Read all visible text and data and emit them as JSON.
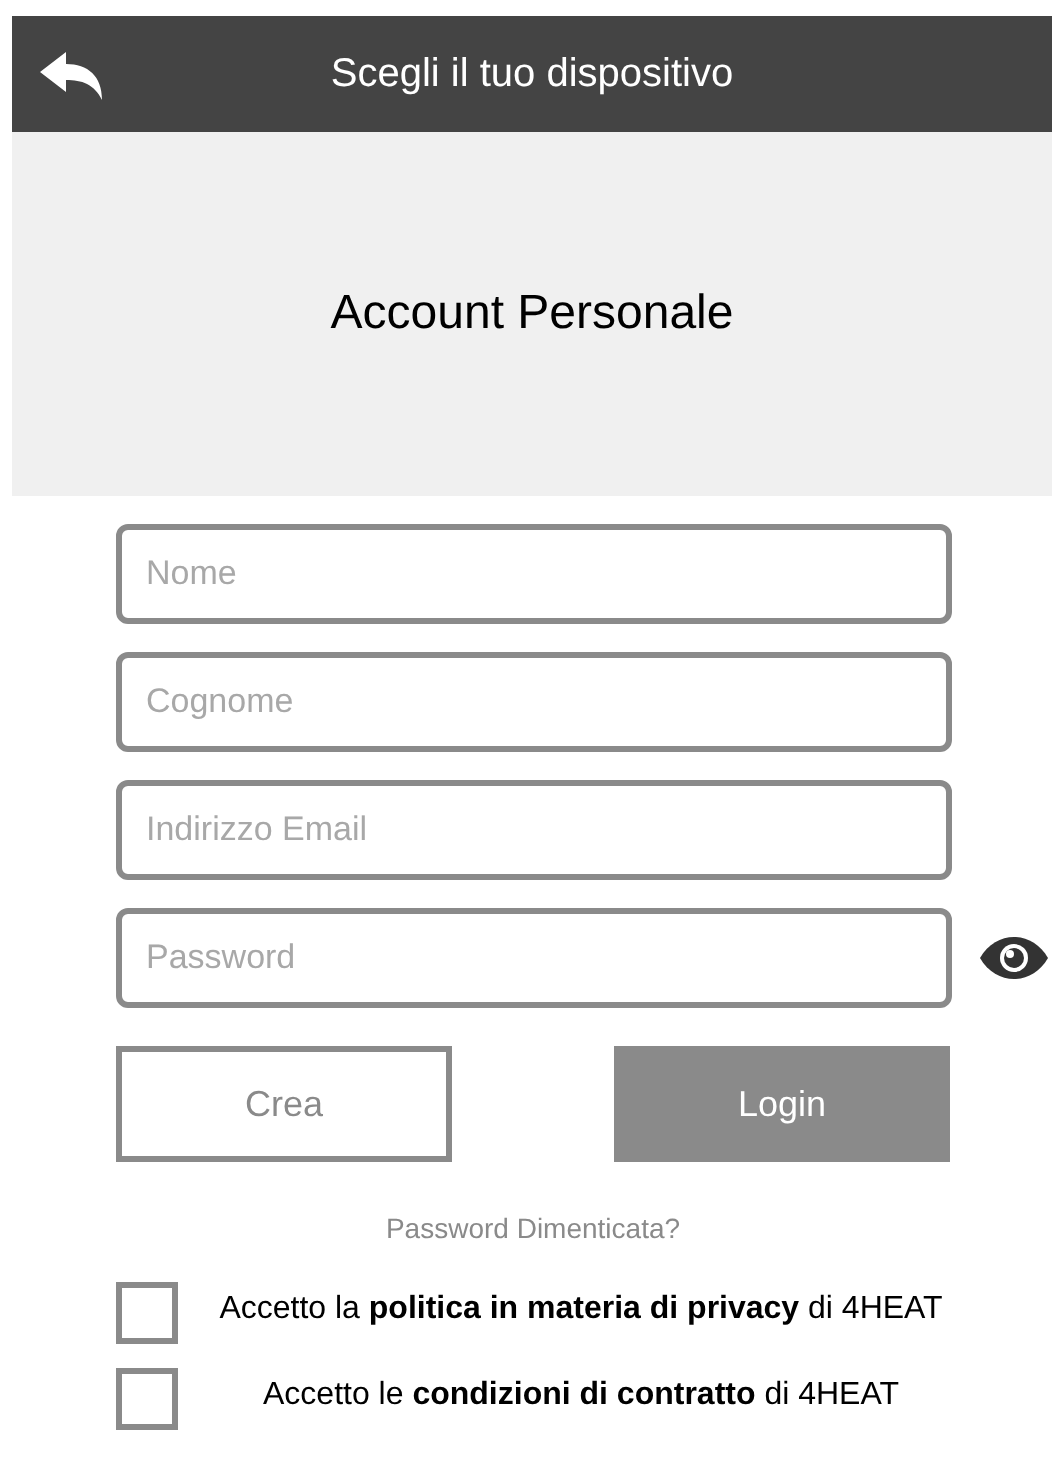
{
  "header": {
    "title": "Scegli il tuo dispositivo"
  },
  "banner": {
    "title": "Account Personale"
  },
  "fields": [
    {
      "placeholder": "Nome"
    },
    {
      "placeholder": "Cognome"
    },
    {
      "placeholder": "Indirizzo Email"
    },
    {
      "placeholder": "Password",
      "kind": "password"
    }
  ],
  "buttons": [
    {
      "label": "Crea",
      "kind": "outline"
    },
    {
      "label": "Login",
      "kind": "filled"
    }
  ],
  "forgot_link": "Password Dimenticata?",
  "consents": [
    {
      "text": "Accetto la **politica in materia di privacy** di 4HEAT",
      "checked": false
    },
    {
      "text": "Accetto le **condizioni di contratto** di 4HEAT",
      "checked": false
    }
  ]
}
